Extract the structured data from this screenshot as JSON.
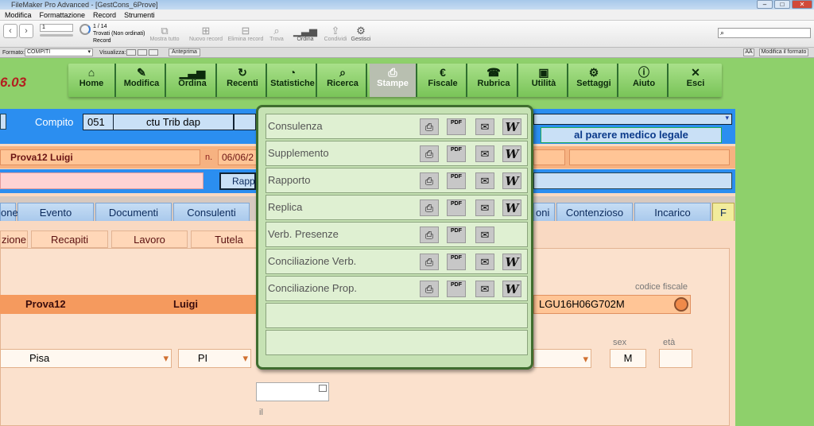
{
  "window": {
    "title": "FileMaker Pro Advanced - [GestCons_6Prove]"
  },
  "menu": [
    "Modifica",
    "Formattazione",
    "Record",
    "Strumenti"
  ],
  "toolbar": {
    "record_of": "1 / 14",
    "found": "Trovati (Non ordinati)",
    "record_label": "Record",
    "record_value": "1",
    "items": [
      "Mostra tutto",
      "Nuovo record",
      "Elimina record",
      "Trova",
      "Ordina",
      "Condividi",
      "Gestisci"
    ]
  },
  "statusbar": {
    "format_label": "Formato:",
    "format_value": "COMPITI",
    "view_label": "Visualizza:",
    "preview": "Anteprima",
    "modify_format": "Modifica il formato",
    "aa": "AÄ"
  },
  "version": "6.03",
  "menu_buttons": [
    {
      "label": "Home",
      "icon": "home-icon",
      "glyph": "⌂"
    },
    {
      "label": "Modifica",
      "icon": "pencil-icon",
      "glyph": "✎"
    },
    {
      "label": "Ordina",
      "icon": "bar-chart-icon",
      "glyph": "▁▃▅"
    },
    {
      "label": "Recenti",
      "icon": "refresh-icon",
      "glyph": "↻"
    },
    {
      "label": "Statistiche",
      "icon": "pie-chart-icon",
      "glyph": "◔"
    },
    {
      "label": "Ricerca",
      "icon": "search-icon",
      "glyph": "⌕"
    },
    {
      "label": "Stampe",
      "icon": "printer-icon",
      "glyph": "⎙"
    },
    {
      "label": "Fiscale",
      "icon": "euro-icon",
      "glyph": "€"
    },
    {
      "label": "Rubrica",
      "icon": "phone-icon",
      "glyph": "☎"
    },
    {
      "label": "Utilità",
      "icon": "box-icon",
      "glyph": "▣"
    },
    {
      "label": "Settaggi",
      "icon": "gear-icon",
      "glyph": "⚙"
    },
    {
      "label": "Aiuto",
      "icon": "info-icon",
      "glyph": "ⓘ"
    },
    {
      "label": "Esci",
      "icon": "close-icon",
      "glyph": "✕"
    }
  ],
  "record": {
    "compito_label": "Compito",
    "compito_num": "051",
    "compito_desc": "ctu Trib dap",
    "parere": "al parere medico legale",
    "person": "Prova12  Luigi",
    "n_label": "n.",
    "date": "06/06/2",
    "rapp": "Rappo"
  },
  "tabs": [
    "one",
    "Evento",
    "Documenti",
    "Consulenti",
    "oni",
    "Contenzioso",
    "Incarico",
    "F"
  ],
  "subtabs": [
    "zione",
    "Recapiti",
    "Lavoro",
    "Tutela"
  ],
  "details": {
    "cognome": "Prova12",
    "nome": "Luigi",
    "codice_fiscale_label": "codice fiscale",
    "codice_fiscale": "LGU16H06G702M",
    "citta": "Pisa",
    "prov": "PI",
    "sex_label": "sex",
    "sex": "M",
    "eta_label": "età",
    "il_label": "il"
  },
  "stampe": {
    "rows": [
      {
        "label": "Consulenza",
        "print": true,
        "pdf": true,
        "mail": true,
        "word": true
      },
      {
        "label": "Supplemento",
        "print": true,
        "pdf": true,
        "mail": true,
        "word": true
      },
      {
        "label": "Rapporto",
        "print": true,
        "pdf": true,
        "mail": true,
        "word": true
      },
      {
        "label": "Replica",
        "print": true,
        "pdf": true,
        "mail": true,
        "word": true
      },
      {
        "label": "Verb. Presenze",
        "print": true,
        "pdf": true,
        "mail": true,
        "word": false
      },
      {
        "label": "Conciliazione Verb.",
        "print": true,
        "pdf": true,
        "mail": true,
        "word": true
      },
      {
        "label": "Conciliazione Prop.",
        "print": true,
        "pdf": true,
        "mail": true,
        "word": true
      },
      {
        "label": "",
        "print": false,
        "pdf": false,
        "mail": false,
        "word": false
      },
      {
        "label": "",
        "print": false,
        "pdf": false,
        "mail": false,
        "word": false
      }
    ],
    "pdf_text": "PDF",
    "word_text": "W",
    "print_glyph": "⎙",
    "mail_glyph": "✉"
  }
}
